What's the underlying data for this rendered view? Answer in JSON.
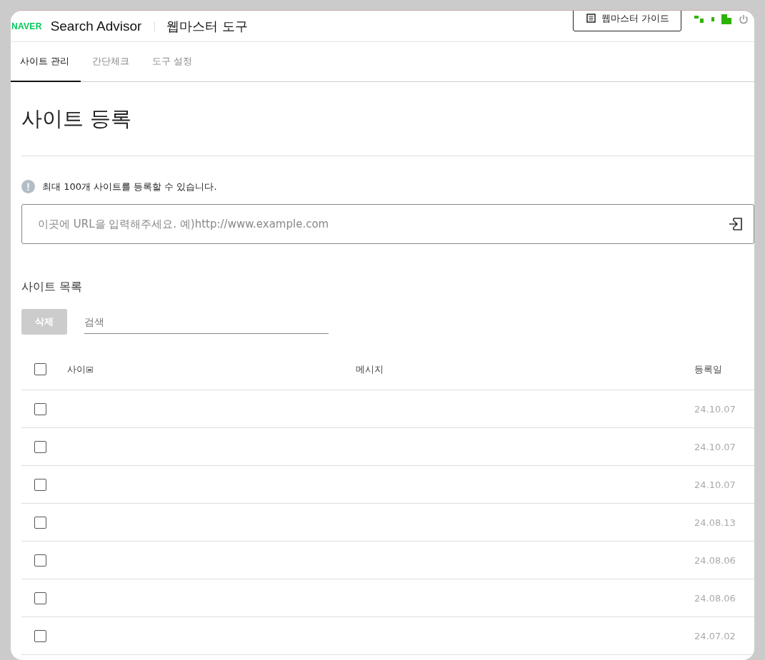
{
  "header": {
    "brand": "NAVER",
    "product": "Search Advisor",
    "title": "웹마스터 도구",
    "guide_button": "웹마스터 가이드"
  },
  "tabs": [
    {
      "label": "사이트 관리",
      "selected": true
    },
    {
      "label": "간단체크",
      "selected": false
    },
    {
      "label": "도구 설정",
      "selected": false
    }
  ],
  "page_title": "사이트 등록",
  "notice": "최대 100개 사이트를 등록할 수 있습니다.",
  "url_field": {
    "placeholder": "이곳에 URL을 입력해주세요. 예)http://www.example.com"
  },
  "list_title": "사이트 목록",
  "delete_button": {
    "label": "삭제",
    "disabled": true
  },
  "search_field": {
    "placeholder": "검색"
  },
  "table": {
    "columns": [
      "사이",
      "메시지",
      "등록일"
    ],
    "all_checked": false,
    "rows": [
      {
        "checked": false,
        "date": "24.10.07"
      },
      {
        "checked": false,
        "date": "24.10.07"
      },
      {
        "checked": false,
        "date": "24.10.07"
      },
      {
        "checked": false,
        "date": "24.08.13"
      },
      {
        "checked": false,
        "date": "24.08.06"
      },
      {
        "checked": false,
        "date": "24.08.06"
      },
      {
        "checked": false,
        "date": "24.07.02"
      }
    ]
  }
}
